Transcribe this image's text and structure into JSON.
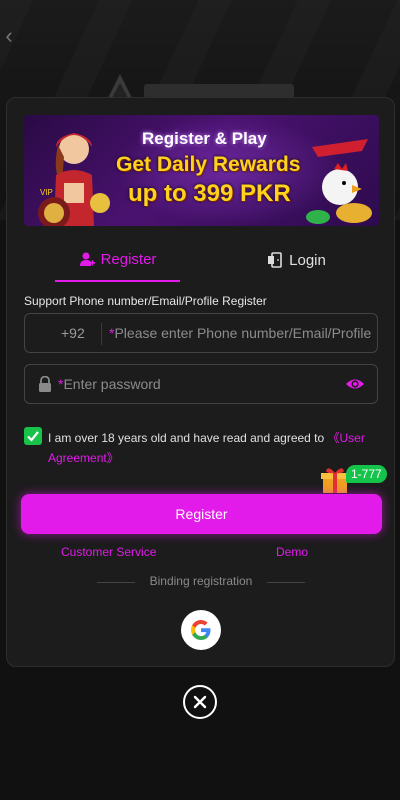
{
  "banner": {
    "line1": "Register & Play",
    "line2": "Get Daily Rewards",
    "line3": "up to 399 PKR",
    "vip_text": "VIP"
  },
  "tabs": {
    "register_label": "Register",
    "login_label": "Login"
  },
  "form": {
    "support_label": "Support Phone number/Email/Profile Register",
    "phone_prefix": "+92",
    "phone_placeholder": "Please enter Phone number/Email/Profile",
    "password_placeholder": "Enter password",
    "required_mark": "*"
  },
  "agreement": {
    "text": "I am over 18 years old and have read and agreed to ",
    "link": "《User Agreement》",
    "checked": true
  },
  "promo_badge": "1-777",
  "register_button": "Register",
  "links": {
    "customer_service": "Customer Service",
    "demo": "Demo"
  },
  "binding_label": "Binding registration",
  "colors": {
    "accent": "#e21bea",
    "check": "#19c34a",
    "modal_bg": "#1c1c1c",
    "banner_gold": "#ffd21f"
  }
}
